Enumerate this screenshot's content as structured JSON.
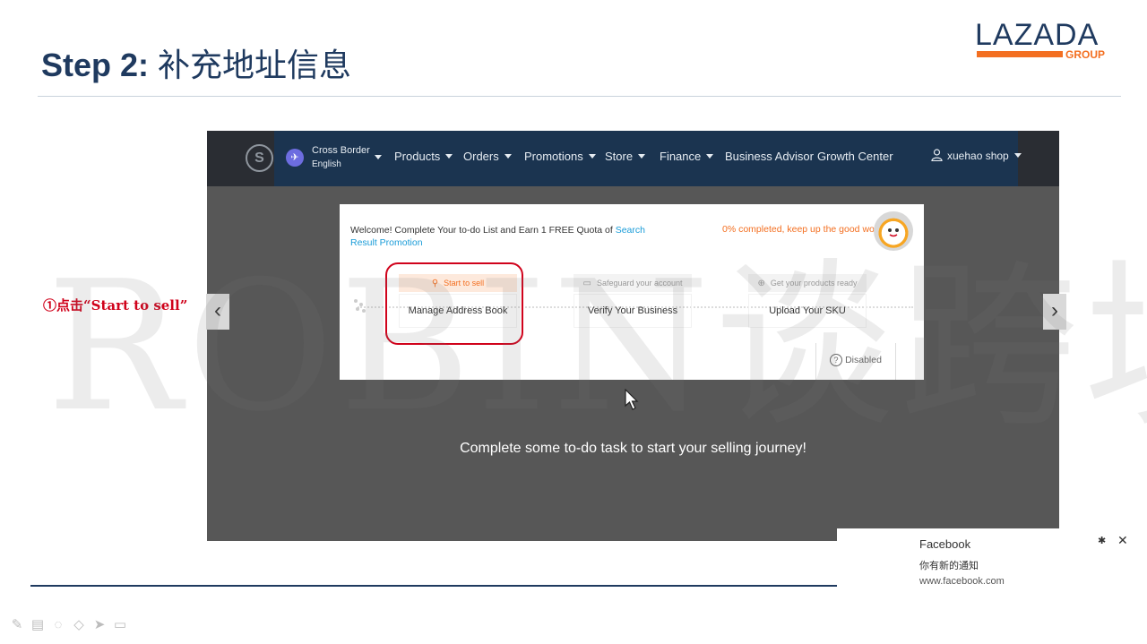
{
  "slide": {
    "title_bold": "Step 2:",
    "title_cn": "补充地址信息",
    "annotation": "①点击“Start to sell”",
    "watermark": "ROBIN谈跨境"
  },
  "logo": {
    "text": "LAZADA",
    "group": "GROUP",
    "accent_color": "#f36f21",
    "text_color": "#1f3a5f"
  },
  "nav": {
    "brand_icon": "S",
    "cross_border": {
      "label": "Cross Border",
      "sub": "English"
    },
    "items": [
      "Products",
      "Orders",
      "Promotions",
      "Store",
      "Finance",
      "Business Advisor",
      "Growth Center"
    ],
    "user": "xuehao shop",
    "bg_color": "#1b3450"
  },
  "card": {
    "welcome_text": "Welcome! Complete Your to-do List and Earn 1 FREE Quota of ",
    "welcome_link": "Search Result Promotion",
    "progress": "0% completed, keep up the good work!",
    "steps": [
      {
        "tag": "Start to sell",
        "task": "Manage Address Book",
        "icon": "pin-icon"
      },
      {
        "tag": "Safeguard your account",
        "task": "Verify Your Business",
        "icon": "card-icon"
      },
      {
        "tag": "Get your products ready",
        "task": "Upload Your SKU",
        "icon": "plus-circle-icon"
      }
    ],
    "disabled": "Disabled"
  },
  "screen_message": "Complete some to-do task to start your selling journey!",
  "notification": {
    "title": "Facebook",
    "message": "你有新的通知",
    "url": "www.facebook.com"
  },
  "carousel": {
    "prev": "‹",
    "next": "›"
  },
  "toolbar_icons": [
    "pen-icon",
    "slides-icon",
    "eraser-icon",
    "highlighter-icon",
    "pointer-icon",
    "camera-icon"
  ]
}
